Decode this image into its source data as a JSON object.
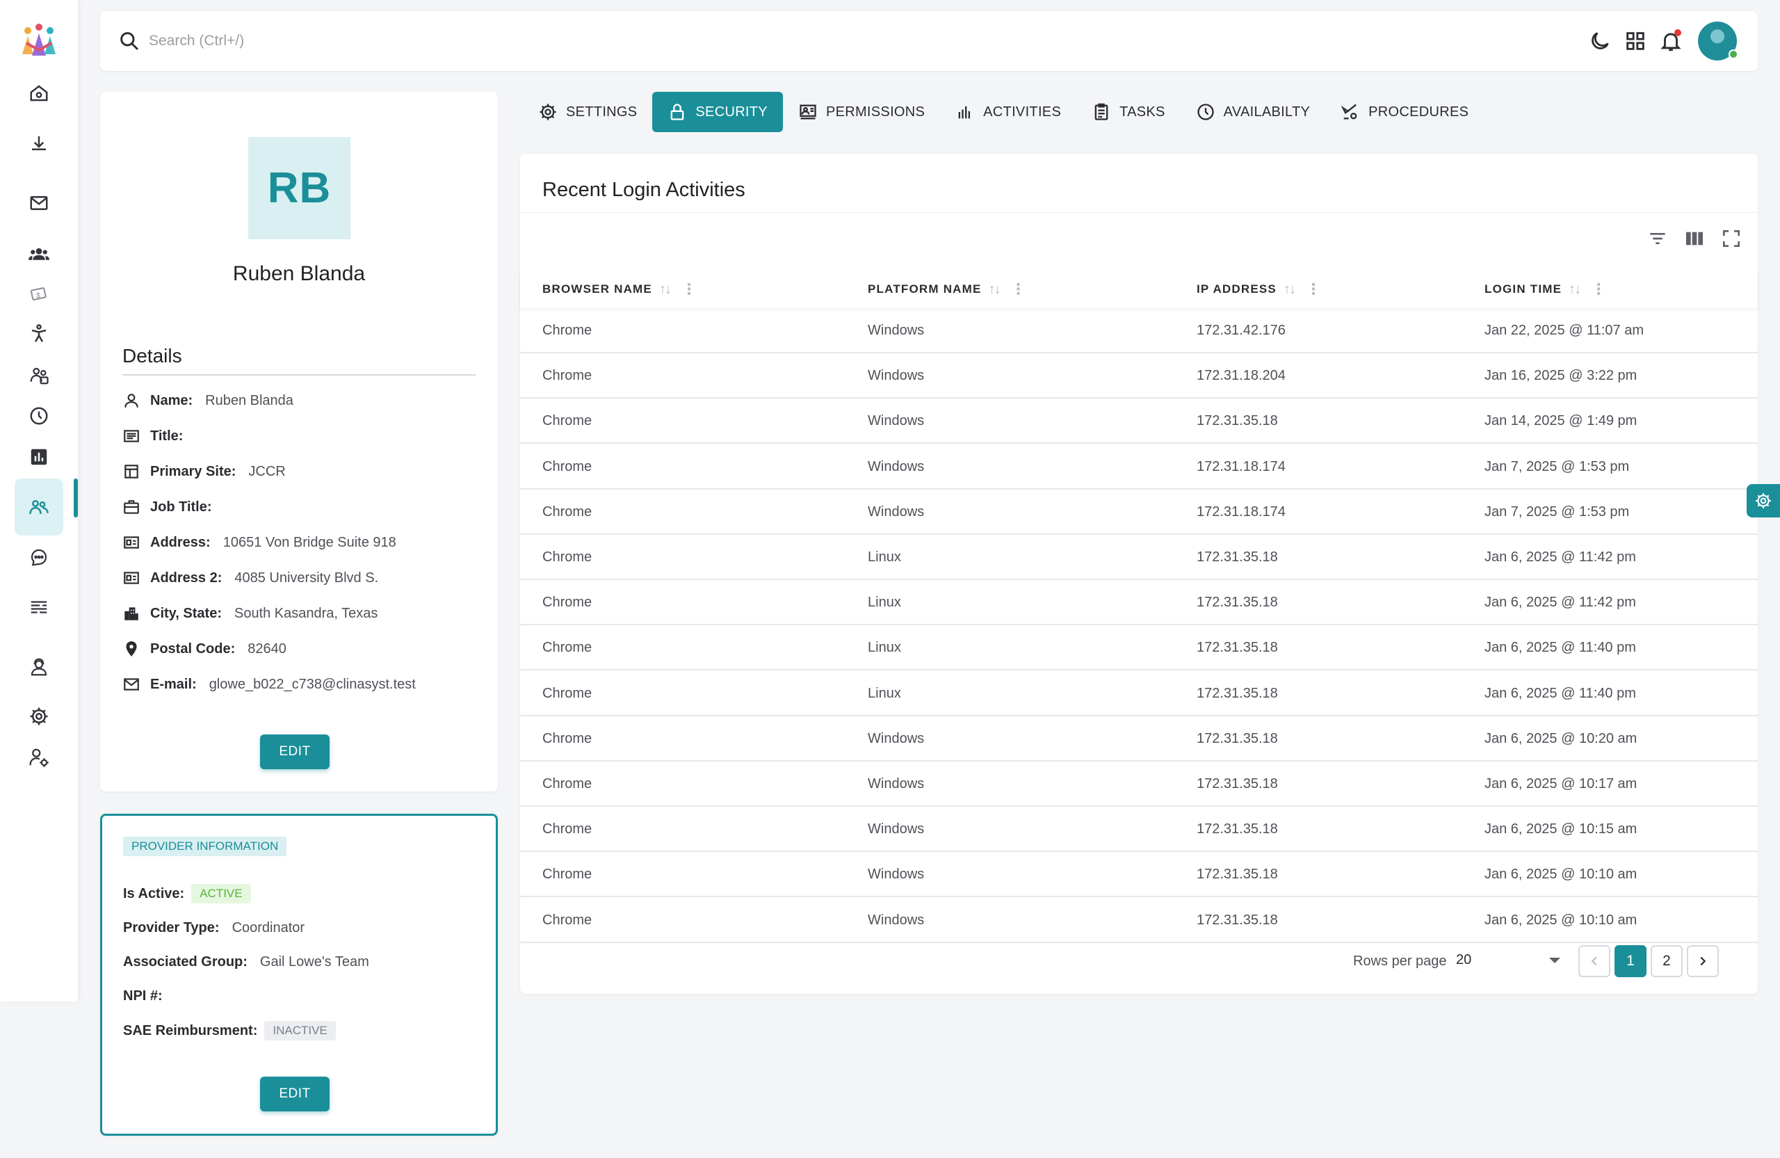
{
  "search": {
    "placeholder": "Search (Ctrl+/)"
  },
  "colors": {
    "accent": "#1a8f99",
    "accent_light": "#d9eff1",
    "active_green": "#58b43a"
  },
  "sidebar": {
    "items": [
      {
        "name": "home",
        "icon": "home-icon"
      },
      {
        "name": "download",
        "icon": "download-icon"
      },
      {
        "name": "mail",
        "icon": "mail-icon"
      },
      {
        "name": "groups",
        "icon": "people-icon"
      },
      {
        "name": "money",
        "icon": "money-icon"
      },
      {
        "name": "accessibility",
        "icon": "accessibility-icon"
      },
      {
        "name": "team",
        "icon": "team-icon"
      },
      {
        "name": "history",
        "icon": "clock-icon"
      },
      {
        "name": "reports",
        "icon": "bar-chart-icon"
      },
      {
        "name": "users",
        "icon": "users-icon",
        "active": true
      },
      {
        "name": "chat",
        "icon": "chat-icon"
      },
      {
        "name": "list",
        "icon": "list-icon"
      },
      {
        "name": "support",
        "icon": "support-agent-icon"
      },
      {
        "name": "settings",
        "icon": "gear-icon"
      },
      {
        "name": "user-settings",
        "icon": "user-gear-icon"
      }
    ]
  },
  "profile": {
    "initials": "RB",
    "name": "Ruben Blanda",
    "details_heading": "Details",
    "fields": [
      {
        "label": "Name:",
        "value": "Ruben Blanda",
        "icon": "person-icon"
      },
      {
        "label": "Title:",
        "value": "",
        "icon": "title-icon"
      },
      {
        "label": "Primary Site:",
        "value": "JCCR",
        "icon": "site-icon"
      },
      {
        "label": "Job Title:",
        "value": "",
        "icon": "briefcase-icon"
      },
      {
        "label": "Address:",
        "value": "10651 Von Bridge Suite 918",
        "icon": "id-card-icon"
      },
      {
        "label": "Address 2:",
        "value": "4085 University Blvd S.",
        "icon": "id-card-icon"
      },
      {
        "label": "City, State:",
        "value": "South Kasandra, Texas",
        "icon": "city-icon"
      },
      {
        "label": "Postal Code:",
        "value": "82640",
        "icon": "location-pin-icon"
      },
      {
        "label": "E-mail:",
        "value": "glowe_b022_c738@clinasyst.test",
        "icon": "mail-icon"
      }
    ],
    "edit_label": "EDIT"
  },
  "provider": {
    "badge": "PROVIDER INFORMATION",
    "is_active_label": "Is Active:",
    "is_active_value": "ACTIVE",
    "provider_type_label": "Provider Type:",
    "provider_type_value": "Coordinator",
    "group_label": "Associated Group:",
    "group_value": "Gail Lowe's Team",
    "npi_label": "NPI #:",
    "npi_value": "",
    "sae_label": "SAE Reimbursment:",
    "sae_value": "INACTIVE",
    "edit_label": "EDIT"
  },
  "tabs": [
    {
      "label": "SETTINGS",
      "icon": "gear-icon"
    },
    {
      "label": "SECURITY",
      "icon": "lock-icon",
      "active": true
    },
    {
      "label": "PERMISSIONS",
      "icon": "permissions-icon"
    },
    {
      "label": "ACTIVITIES",
      "icon": "bar-chart-icon"
    },
    {
      "label": "TASKS",
      "icon": "clipboard-icon"
    },
    {
      "label": "AVAILABILTY",
      "icon": "clock-icon"
    },
    {
      "label": "PROCEDURES",
      "icon": "procedures-icon"
    }
  ],
  "login_table": {
    "title": "Recent Login Activities",
    "columns": [
      "BROWSER NAME",
      "PLATFORM NAME",
      "IP ADDRESS",
      "LOGIN TIME"
    ],
    "rows": [
      [
        "Chrome",
        "Windows",
        "172.31.42.176",
        "Jan 22, 2025 @ 11:07 am"
      ],
      [
        "Chrome",
        "Windows",
        "172.31.18.204",
        "Jan 16, 2025 @ 3:22 pm"
      ],
      [
        "Chrome",
        "Windows",
        "172.31.35.18",
        "Jan 14, 2025 @ 1:49 pm"
      ],
      [
        "Chrome",
        "Windows",
        "172.31.18.174",
        "Jan 7, 2025 @ 1:53 pm"
      ],
      [
        "Chrome",
        "Windows",
        "172.31.18.174",
        "Jan 7, 2025 @ 1:53 pm"
      ],
      [
        "Chrome",
        "Linux",
        "172.31.35.18",
        "Jan 6, 2025 @ 11:42 pm"
      ],
      [
        "Chrome",
        "Linux",
        "172.31.35.18",
        "Jan 6, 2025 @ 11:42 pm"
      ],
      [
        "Chrome",
        "Linux",
        "172.31.35.18",
        "Jan 6, 2025 @ 11:40 pm"
      ],
      [
        "Chrome",
        "Linux",
        "172.31.35.18",
        "Jan 6, 2025 @ 11:40 pm"
      ],
      [
        "Chrome",
        "Windows",
        "172.31.35.18",
        "Jan 6, 2025 @ 10:20 am"
      ],
      [
        "Chrome",
        "Windows",
        "172.31.35.18",
        "Jan 6, 2025 @ 10:17 am"
      ],
      [
        "Chrome",
        "Windows",
        "172.31.35.18",
        "Jan 6, 2025 @ 10:15 am"
      ],
      [
        "Chrome",
        "Windows",
        "172.31.35.18",
        "Jan 6, 2025 @ 10:10 am"
      ],
      [
        "Chrome",
        "Windows",
        "172.31.35.18",
        "Jan 6, 2025 @ 10:10 am"
      ]
    ],
    "rows_per_page_label": "Rows per page",
    "rows_per_page_value": "20",
    "pages": [
      "1",
      "2"
    ],
    "current_page": "1"
  }
}
